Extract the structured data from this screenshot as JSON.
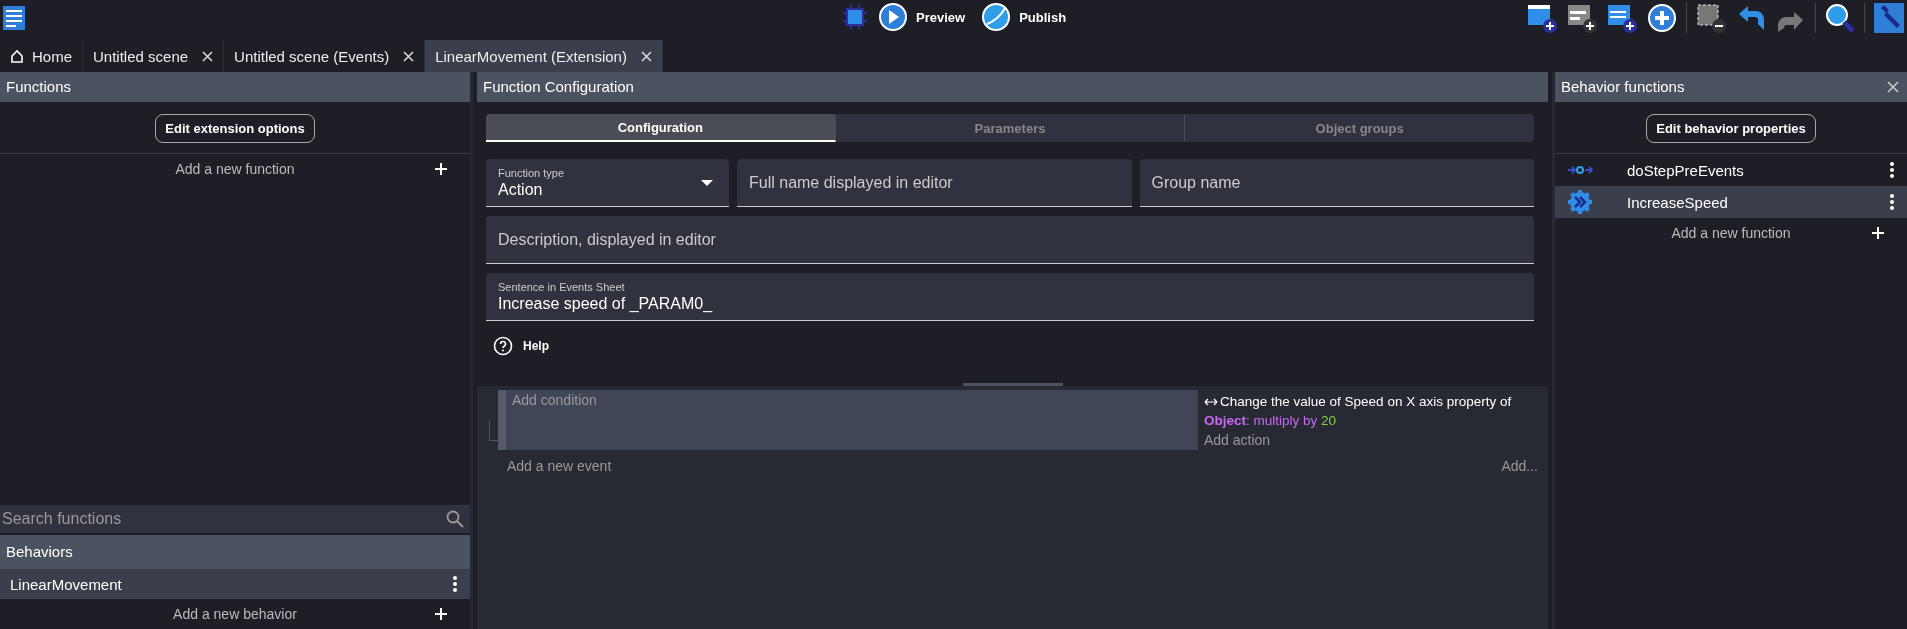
{
  "toolbar": {
    "center": [
      {
        "kind": "debug"
      },
      {
        "kind": "preview",
        "label": "Preview"
      },
      {
        "kind": "publish",
        "label": "Publish"
      }
    ],
    "right": [
      {
        "kind": "add-scene"
      },
      {
        "kind": "add-external-events"
      },
      {
        "kind": "add-external-layout"
      },
      {
        "kind": "add-object"
      },
      {
        "kind": "remove-selection"
      },
      {
        "kind": "undo"
      },
      {
        "kind": "redo"
      },
      {
        "kind": "search"
      },
      {
        "kind": "settings"
      }
    ]
  },
  "tabs": [
    {
      "label": "Home",
      "kind": "home",
      "selected": false
    },
    {
      "label": "Untitled scene",
      "kind": "closable",
      "selected": false
    },
    {
      "label": "Untitled scene (Events)",
      "kind": "closable",
      "selected": false
    },
    {
      "label": "LinearMovement (Extension)",
      "kind": "closable",
      "selected": true
    }
  ],
  "functions_panel": {
    "title": "Functions",
    "edit_button": "Edit extension options",
    "add_function": "Add a new function",
    "search": {
      "placeholder": "Search functions"
    },
    "behaviors_title": "Behaviors",
    "behaviors": [
      {
        "name": "LinearMovement",
        "selected": true
      }
    ],
    "add_behavior": "Add a new behavior"
  },
  "config_panel": {
    "title": "Function Configuration",
    "tabs": [
      {
        "label": "Configuration",
        "selected": true
      },
      {
        "label": "Parameters",
        "selected": false
      },
      {
        "label": "Object groups",
        "selected": false
      }
    ],
    "function_type": {
      "label": "Function type",
      "value": "Action"
    },
    "full_name": {
      "placeholder": "Full name displayed in editor"
    },
    "group_name": {
      "placeholder": "Group name"
    },
    "description": {
      "placeholder": "Description, displayed in editor"
    },
    "sentence": {
      "label": "Sentence in Events Sheet",
      "value": "Increase speed of _PARAM0_"
    },
    "help": "Help"
  },
  "events": {
    "add_condition": "Add condition",
    "action": {
      "text": "Change the value of Speed on X axis property of",
      "object": "Object",
      "operation": ": multiply by",
      "value": "20"
    },
    "add_action": "Add action",
    "add_event": "Add a new event",
    "add_more": "Add..."
  },
  "behavior_panel": {
    "title": "Behavior functions",
    "edit_button": "Edit behavior properties",
    "functions": [
      {
        "name": "doStepPreEvents",
        "kind": "lifecycle",
        "selected": false
      },
      {
        "name": "IncreaseSpeed",
        "kind": "action",
        "selected": true
      }
    ],
    "add_function": "Add a new function"
  }
}
